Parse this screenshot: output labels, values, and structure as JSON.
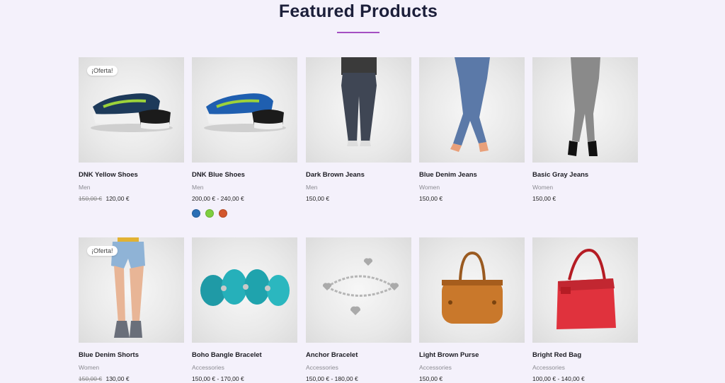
{
  "section": {
    "title": "Featured Products",
    "accent": "#a44fc2"
  },
  "products": [
    {
      "name": "DNK Yellow Shoes",
      "category": "Men",
      "old_price": "150,00 €",
      "price": "120,00 €",
      "badge": "¡Oferta!",
      "image": "sneakers-icon"
    },
    {
      "name": "DNK Blue Shoes",
      "category": "Men",
      "old_price": "",
      "price": "200,00 € - 240,00 €",
      "badge": "",
      "image": "sneakers-icon",
      "swatches": [
        "#2a6fb5",
        "#7fcf3f",
        "#d3572c"
      ]
    },
    {
      "name": "Dark Brown Jeans",
      "category": "Men",
      "old_price": "",
      "price": "150,00 €",
      "badge": "",
      "image": "jeans-icon"
    },
    {
      "name": "Blue Denim Jeans",
      "category": "Women",
      "old_price": "",
      "price": "150,00 €",
      "badge": "",
      "image": "jeans-icon"
    },
    {
      "name": "Basic Gray Jeans",
      "category": "Women",
      "old_price": "",
      "price": "150,00 €",
      "badge": "",
      "image": "jeans-icon"
    },
    {
      "name": "Blue Denim Shorts",
      "category": "Women",
      "old_price": "150,00 €",
      "price": "130,00 €",
      "badge": "¡Oferta!",
      "image": "shorts-icon"
    },
    {
      "name": "Boho Bangle Bracelet",
      "category": "Accessories",
      "old_price": "",
      "price": "150,00 € - 170,00 €",
      "badge": "",
      "image": "bracelet-icon"
    },
    {
      "name": "Anchor Bracelet",
      "category": "Accessories",
      "old_price": "",
      "price": "150,00 € - 180,00 €",
      "badge": "",
      "image": "charm-bracelet-icon"
    },
    {
      "name": "Light Brown Purse",
      "category": "Accessories",
      "old_price": "",
      "price": "150,00 €",
      "badge": "",
      "image": "purse-icon"
    },
    {
      "name": "Bright Red Bag",
      "category": "Accessories",
      "old_price": "",
      "price": "100,00 € - 140,00 €",
      "badge": "",
      "image": "bag-icon"
    }
  ]
}
